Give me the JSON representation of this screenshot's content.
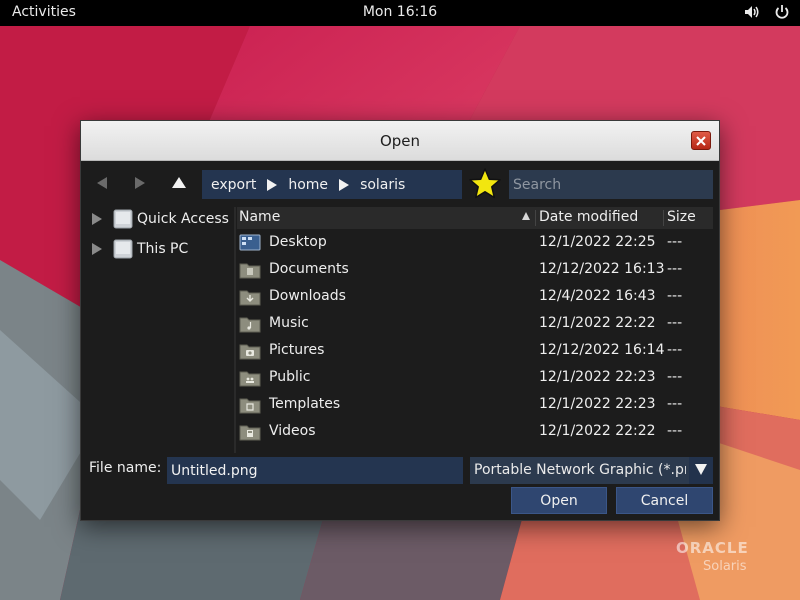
{
  "topbar": {
    "activities": "Activities",
    "clock": "Mon 16:16",
    "volume_icon": "volume-icon",
    "power_icon": "power-icon"
  },
  "dialog": {
    "title": "Open",
    "close_icon": "close-icon"
  },
  "toolbar": {
    "back_icon": "back-arrow-icon",
    "forward_icon": "forward-arrow-icon",
    "up_icon": "up-arrow-icon",
    "path": [
      "export",
      "home",
      "solaris"
    ],
    "favorite_icon": "star-icon",
    "search_placeholder": "Search"
  },
  "sidebar": {
    "items": [
      {
        "label": "Quick Access",
        "icon": "drive-icon"
      },
      {
        "label": "This PC",
        "icon": "drive-icon"
      }
    ]
  },
  "filelist": {
    "columns": {
      "name": "Name",
      "date": "Date modified",
      "size": "Size"
    },
    "sort_icon": "sort-ascending-icon",
    "rows": [
      {
        "name": "Desktop",
        "date": "12/1/2022 22:25",
        "size": "---",
        "icon": "desktop-folder-icon"
      },
      {
        "name": "Documents",
        "date": "12/12/2022 16:13",
        "size": "---",
        "icon": "documents-folder-icon"
      },
      {
        "name": "Downloads",
        "date": "12/4/2022 16:43",
        "size": "---",
        "icon": "downloads-folder-icon"
      },
      {
        "name": "Music",
        "date": "12/1/2022 22:22",
        "size": "---",
        "icon": "music-folder-icon"
      },
      {
        "name": "Pictures",
        "date": "12/12/2022 16:14",
        "size": "---",
        "icon": "pictures-folder-icon"
      },
      {
        "name": "Public",
        "date": "12/1/2022 22:23",
        "size": "---",
        "icon": "public-folder-icon"
      },
      {
        "name": "Templates",
        "date": "12/1/2022 22:23",
        "size": "---",
        "icon": "templates-folder-icon"
      },
      {
        "name": "Videos",
        "date": "12/1/2022 22:22",
        "size": "---",
        "icon": "videos-folder-icon"
      }
    ]
  },
  "bottom": {
    "filename_label": "File name:",
    "filename_value": "Untitled.png",
    "filetype_value": "Portable Network Graphic (*.png)",
    "open_label": "Open",
    "cancel_label": "Cancel"
  },
  "logo": {
    "brand": "ORACLE",
    "product": "Solaris"
  },
  "colors": {
    "accent": "#243550",
    "button": "#2f4670",
    "dialog_bg": "#1c1c1c",
    "folder": "#8d8d7e"
  }
}
